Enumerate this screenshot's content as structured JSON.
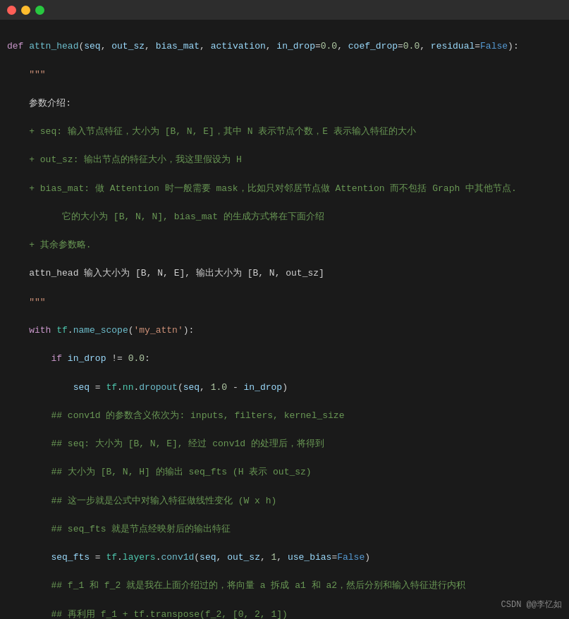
{
  "titlebar": {
    "close_label": "",
    "minimize_label": "",
    "maximize_label": ""
  },
  "watermark": "CSDN @@李忆如",
  "code": {
    "lines": []
  }
}
